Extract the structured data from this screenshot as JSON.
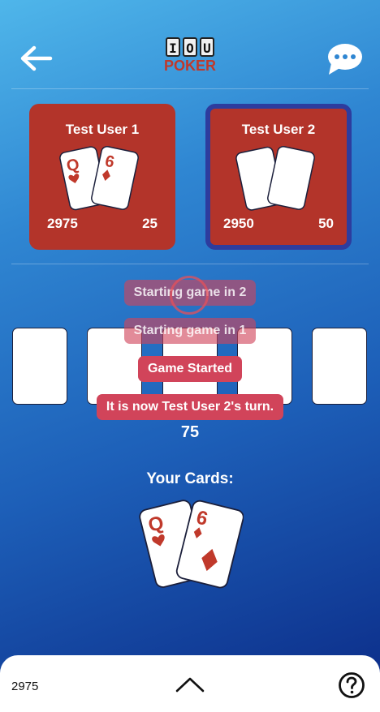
{
  "app": {
    "logo_top": [
      "I",
      "O",
      "U"
    ],
    "logo_word": "POKER"
  },
  "players": [
    {
      "name": "Test User 1",
      "chips": "2975",
      "bet": "25",
      "active": false,
      "cards": [
        {
          "rank": "Q",
          "suit": "hearts"
        },
        {
          "rank": "6",
          "suit": "diamonds"
        }
      ]
    },
    {
      "name": "Test User 2",
      "chips": "2950",
      "bet": "50",
      "active": true,
      "cards": [
        {
          "face_down": true
        },
        {
          "face_down": true
        }
      ]
    }
  ],
  "table": {
    "community_card_count": 5,
    "pot": "75"
  },
  "notifications": [
    {
      "text": "Starting game in 2",
      "faded": true
    },
    {
      "text": "Starting game in 1",
      "faded": true
    },
    {
      "text": "Game Started",
      "faded": false
    },
    {
      "text": "It is now Test User 2's turn.",
      "faded": false
    }
  ],
  "your_cards": {
    "label": "Your Cards:",
    "cards": [
      {
        "rank": "Q",
        "suit": "hearts"
      },
      {
        "rank": "6",
        "suit": "diamonds"
      }
    ]
  },
  "bottom_bar": {
    "chips": "2975"
  },
  "icons": {
    "back": "arrow-left-icon",
    "chat": "chat-bubble-icon",
    "expand": "chevron-up-icon",
    "help": "help-circle-icon"
  },
  "colors": {
    "card_red": "#c0392b",
    "player_box": "#b3342a",
    "active_border": "#2d3c9e",
    "toast": "#d1445a"
  }
}
